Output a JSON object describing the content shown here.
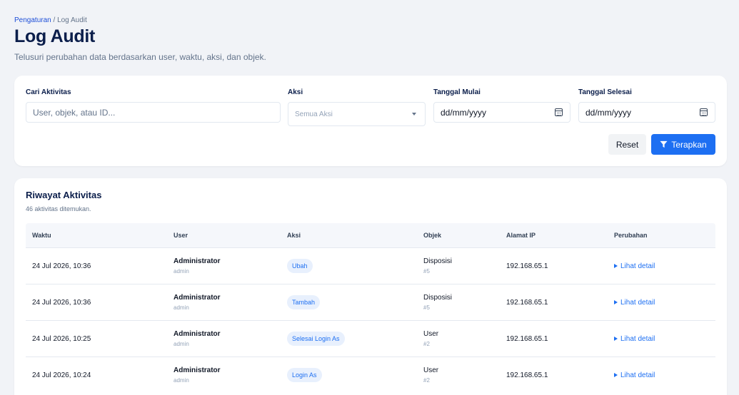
{
  "breadcrumb": {
    "parent": "Pengaturan",
    "separator": " / ",
    "current": "Log Audit"
  },
  "page": {
    "title": "Log Audit",
    "subtitle": "Telusuri perubahan data berdasarkan user, waktu, aksi, dan objek."
  },
  "filters": {
    "search": {
      "label": "Cari Aktivitas",
      "placeholder": "User, objek, atau ID..."
    },
    "action": {
      "label": "Aksi",
      "selected": "Semua Aksi"
    },
    "start_date": {
      "label": "Tanggal Mulai",
      "value": "dd/mm/yyyy",
      "icon": "calendar-icon"
    },
    "end_date": {
      "label": "Tanggal Selesai",
      "value": "dd/mm/yyyy",
      "icon": "calendar-icon"
    },
    "reset_label": "Reset",
    "apply_label": "Terapkan",
    "apply_icon": "filter-icon"
  },
  "history": {
    "title": "Riwayat Aktivitas",
    "count_text": "46 aktivitas ditemukan.",
    "columns": [
      "Waktu",
      "User",
      "Aksi",
      "Objek",
      "Alamat IP",
      "Perubahan"
    ],
    "rows": [
      {
        "time": "24 Jul 2026, 10:36",
        "user": "Administrator",
        "username": "admin",
        "action": "Ubah",
        "object": "Disposisi",
        "object_id": "#5",
        "ip": "192.168.65.1",
        "detail": "Lihat detail"
      },
      {
        "time": "24 Jul 2026, 10:36",
        "user": "Administrator",
        "username": "admin",
        "action": "Tambah",
        "object": "Disposisi",
        "object_id": "#5",
        "ip": "192.168.65.1",
        "detail": "Lihat detail"
      },
      {
        "time": "24 Jul 2026, 10:25",
        "user": "Administrator",
        "username": "admin",
        "action": "Selesai Login As",
        "object": "User",
        "object_id": "#2",
        "ip": "192.168.65.1",
        "detail": "Lihat detail"
      },
      {
        "time": "24 Jul 2026, 10:24",
        "user": "Administrator",
        "username": "admin",
        "action": "Login As",
        "object": "User",
        "object_id": "#2",
        "ip": "192.168.65.1",
        "detail": "Lihat detail"
      }
    ]
  },
  "colors": {
    "accent": "#1d6ff2",
    "title": "#0b1e4b",
    "background": "#f1f3f7",
    "badge_bg": "#e8f0fd"
  }
}
